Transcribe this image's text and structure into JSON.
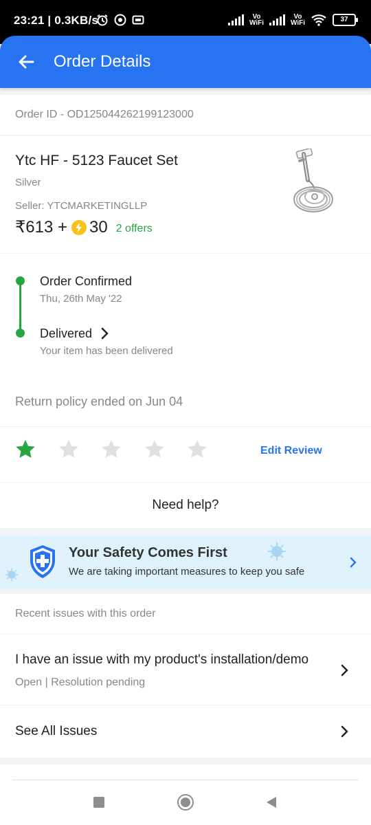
{
  "status_bar": {
    "time": "23:21",
    "speed": "0.3KB/s",
    "vo_wifi_1": [
      "Vo",
      "WiFi"
    ],
    "vo_wifi_2": [
      "Vo",
      "WiFi"
    ],
    "battery": "37"
  },
  "app_bar": {
    "title": "Order Details",
    "back_icon": "arrow-left-icon"
  },
  "order": {
    "id_label": "Order ID - OD125044262199123000"
  },
  "product": {
    "name": "Ytc HF - 5123 Faucet Set",
    "color": "Silver",
    "seller": "Seller: YTCMARKETINGLLP",
    "price": "₹613 +",
    "supercoins": "30",
    "offers": "2 offers"
  },
  "timeline": {
    "steps": [
      {
        "title": "Order Confirmed",
        "subtitle": "Thu, 26th May '22"
      },
      {
        "title": "Delivered",
        "subtitle": "Your item has been delivered"
      }
    ],
    "return_policy": "Return policy ended on Jun 04"
  },
  "rating": {
    "value": 1,
    "max": 5,
    "edit_label": "Edit Review"
  },
  "help": {
    "label": "Need help?"
  },
  "safety_banner": {
    "title": "Your Safety Comes First",
    "subtitle": "We are taking important measures to keep you safe"
  },
  "issues": {
    "heading": "Recent issues with this order",
    "items": [
      {
        "title": "I have an issue with my product's installation/demo",
        "status": "Open | Resolution pending"
      }
    ],
    "see_all_label": "See All Issues"
  },
  "colors": {
    "brand_blue": "#2874f0",
    "success_green": "#26a541",
    "muted_text": "#878787",
    "star_empty": "#e0e0e0"
  }
}
